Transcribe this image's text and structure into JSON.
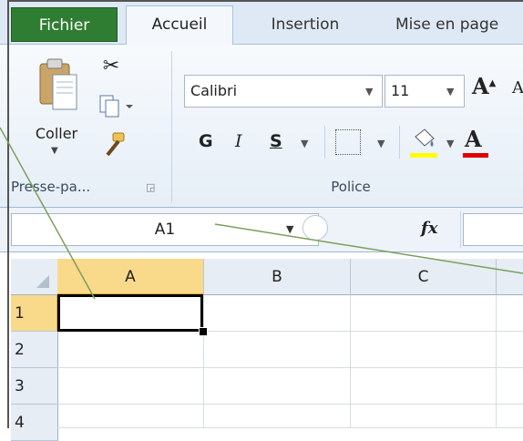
{
  "tabs": {
    "file": "Fichier",
    "home": "Accueil",
    "insert": "Insertion",
    "page_layout": "Mise en page"
  },
  "clipboard": {
    "paste_label": "Coller",
    "group_label": "Presse-pa..."
  },
  "font": {
    "name": "Calibri",
    "size": "11",
    "bold": "G",
    "italic": "I",
    "underline": "S",
    "grow": "A",
    "shrink": "A",
    "color_letter": "A",
    "group_label": "Police",
    "fill_color": "#ffff00",
    "font_color": "#e00000"
  },
  "formula_bar": {
    "name_box": "A1",
    "fx": "fx",
    "formula": ""
  },
  "grid": {
    "columns": [
      "A",
      "B",
      "C"
    ],
    "rows": [
      "1",
      "2",
      "3",
      "4"
    ],
    "selected_column": "A",
    "selected_row": "1"
  },
  "colors": {
    "file_tab": "#2f7d32",
    "selection_header": "#f9d98a",
    "annotation_line": "#7aa05a"
  }
}
